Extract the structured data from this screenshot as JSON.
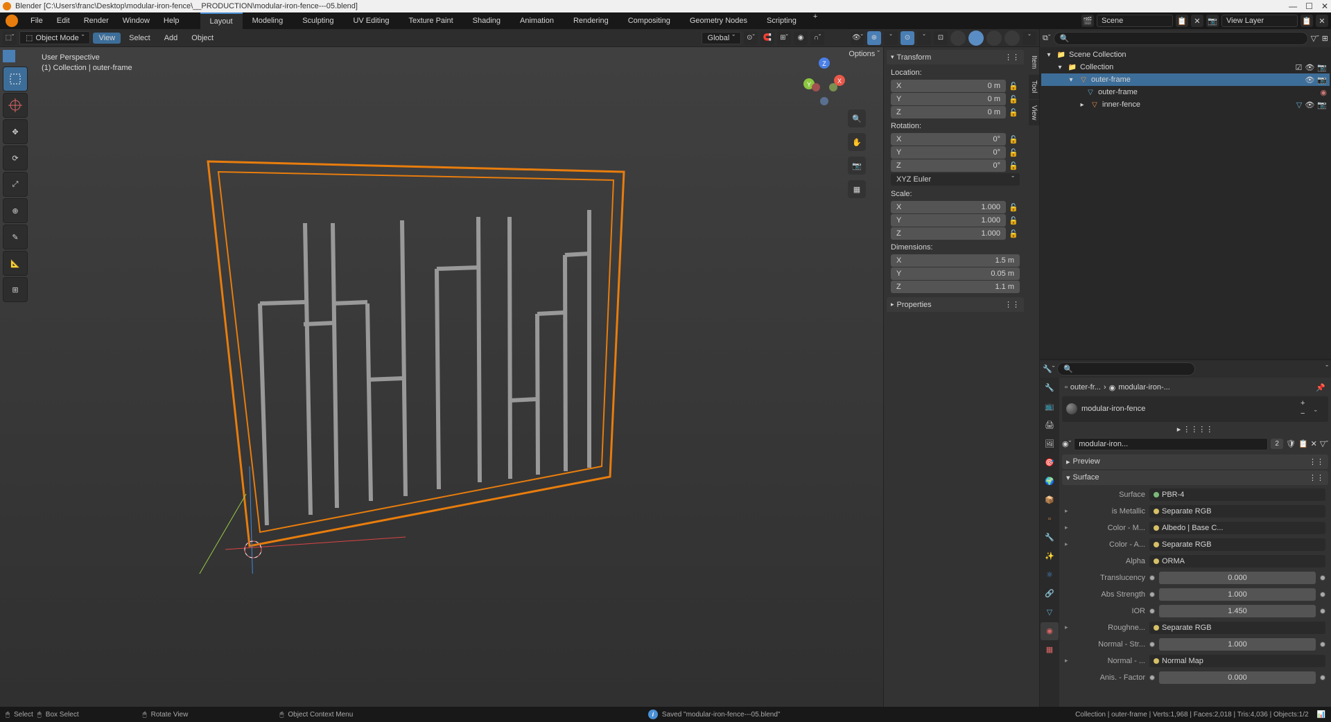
{
  "titlebar": {
    "app": "Blender",
    "path": "[C:\\Users\\franc\\Desktop\\modular-iron-fence\\__PRODUCTION\\modular-iron-fence---05.blend]"
  },
  "menubar": {
    "items": [
      "File",
      "Edit",
      "Render",
      "Window",
      "Help"
    ],
    "workspaces": [
      "Layout",
      "Modeling",
      "Sculpting",
      "UV Editing",
      "Texture Paint",
      "Shading",
      "Animation",
      "Rendering",
      "Compositing",
      "Geometry Nodes",
      "Scripting"
    ],
    "active_workspace": "Layout",
    "scene": "Scene",
    "view_layer": "View Layer"
  },
  "view3d_header": {
    "mode": "Object Mode",
    "menus": [
      "View",
      "Select",
      "Add",
      "Object"
    ],
    "active_menu": "View",
    "orientation": "Global"
  },
  "viewport": {
    "perspective": "User Perspective",
    "context": "(1) Collection | outer-frame",
    "options_label": "Options"
  },
  "npanel": {
    "tabs": [
      "Item",
      "Tool",
      "View"
    ],
    "transform_label": "Transform",
    "location_label": "Location:",
    "rotation_label": "Rotation:",
    "scale_label": "Scale:",
    "dimensions_label": "Dimensions:",
    "rotation_mode": "XYZ Euler",
    "properties_label": "Properties",
    "location": {
      "x": "0 m",
      "y": "0 m",
      "z": "0 m"
    },
    "rotation": {
      "x": "0°",
      "y": "0°",
      "z": "0°"
    },
    "scale": {
      "x": "1.000",
      "y": "1.000",
      "z": "1.000"
    },
    "dimensions": {
      "x": "1.5 m",
      "y": "0.05 m",
      "z": "1.1 m"
    }
  },
  "outliner": {
    "root": "Scene Collection",
    "collection": "Collection",
    "items": [
      {
        "name": "outer-frame",
        "selected": true,
        "type": "mesh"
      },
      {
        "name": "outer-frame",
        "type": "mesh",
        "indent": 1
      },
      {
        "name": "inner-fence",
        "type": "mesh",
        "indent": 1
      }
    ]
  },
  "properties": {
    "breadcrumb_obj": "outer-fr...",
    "breadcrumb_mat": "modular-iron-...",
    "material_name": "modular-iron-fence",
    "material_field": "modular-iron...",
    "users": "2",
    "preview_label": "Preview",
    "surface_label": "Surface",
    "surface_shader": "PBR-4",
    "rows": [
      {
        "expand": true,
        "label": "is Metallic",
        "value": "Separate RGB",
        "dot": "yellow"
      },
      {
        "expand": true,
        "label": "Color - M...",
        "value": "Albedo | Base C...",
        "dot": "yellow"
      },
      {
        "expand": true,
        "label": "Color - A...",
        "value": "Separate RGB",
        "dot": "yellow"
      },
      {
        "expand": false,
        "label": "Alpha",
        "value": "ORMA",
        "dot": "yellow"
      },
      {
        "expand": false,
        "label": "Translucency",
        "value": "0.000",
        "numeric": true
      },
      {
        "expand": false,
        "label": "Abs Strength",
        "value": "1.000",
        "numeric": true
      },
      {
        "expand": false,
        "label": "IOR",
        "value": "1.450",
        "numeric": true
      },
      {
        "expand": true,
        "label": "Roughne...",
        "value": "Separate RGB",
        "dot": "yellow"
      },
      {
        "expand": false,
        "label": "Normal - Str...",
        "value": "1.000",
        "numeric": true
      },
      {
        "expand": true,
        "label": "Normal - ...",
        "value": "Normal Map",
        "dot": "yellow"
      },
      {
        "expand": false,
        "label": "Anis. - Factor",
        "value": "0.000",
        "numeric": true
      }
    ]
  },
  "statusbar": {
    "hints": [
      {
        "icon": "lmb",
        "label": "Select"
      },
      {
        "icon": "lmb-drag",
        "label": "Box Select"
      },
      {
        "icon": "mmb",
        "label": "Rotate View"
      },
      {
        "icon": "rmb",
        "label": "Object Context Menu"
      }
    ],
    "saved": "Saved \"modular-iron-fence---05.blend\"",
    "stats": "Collection | outer-frame | Verts:1,968 | Faces:2,018 | Tris:4,036 | Objects:1/2"
  }
}
